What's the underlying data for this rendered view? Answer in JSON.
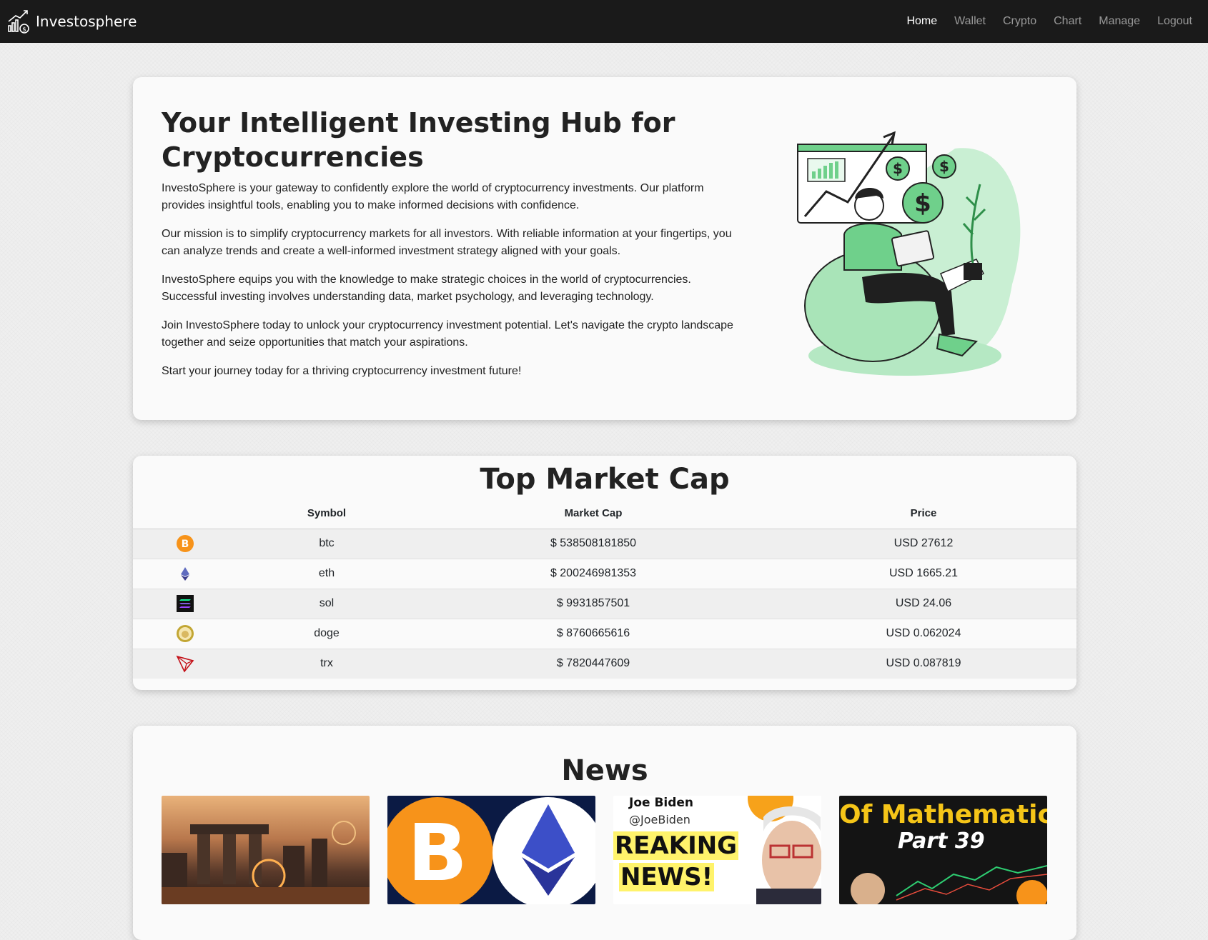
{
  "brand": {
    "name": "Investosphere",
    "icon": "chart-money-icon"
  },
  "nav": [
    {
      "label": "Home",
      "active": true
    },
    {
      "label": "Wallet",
      "active": false
    },
    {
      "label": "Crypto",
      "active": false
    },
    {
      "label": "Chart",
      "active": false
    },
    {
      "label": "Manage",
      "active": false
    },
    {
      "label": "Logout",
      "active": false
    }
  ],
  "hero": {
    "title": "Your Intelligent Investing Hub for Cryptocurrencies",
    "paragraphs": [
      "InvestoSphere is your gateway to confidently explore the world of cryptocurrency investments. Our platform provides insightful tools, enabling you to make informed decisions with confidence.",
      "Our mission is to simplify cryptocurrency markets for all investors. With reliable information at your fingertips, you can analyze trends and create a well-informed investment strategy aligned with your goals.",
      "InvestoSphere equips you with the knowledge to make strategic choices in the world of cryptocurrencies. Successful investing involves understanding data, market psychology, and leveraging technology.",
      "Join InvestoSphere today to unlock your cryptocurrency investment potential. Let's navigate the crypto landscape together and seize opportunities that match your aspirations.",
      "Start your journey today for a thriving cryptocurrency investment future!"
    ]
  },
  "market": {
    "title": "Top Market Cap",
    "headers": [
      "",
      "Symbol",
      "Market Cap",
      "Price"
    ],
    "rows": [
      {
        "icon": "bitcoin-icon",
        "symbol": "btc",
        "market_cap": "$ 538508181850",
        "price": "USD 27612"
      },
      {
        "icon": "ethereum-icon",
        "symbol": "eth",
        "market_cap": "$ 200246981353",
        "price": "USD 1665.21"
      },
      {
        "icon": "solana-icon",
        "symbol": "sol",
        "market_cap": "$ 9931857501",
        "price": "USD 24.06"
      },
      {
        "icon": "dogecoin-icon",
        "symbol": "doge",
        "market_cap": "$ 8760665616",
        "price": "USD 0.062024"
      },
      {
        "icon": "tron-icon",
        "symbol": "trx",
        "market_cap": "$ 7820447609",
        "price": "USD 0.087819"
      }
    ]
  },
  "news": {
    "title": "News",
    "items": [
      {
        "thumb_text": []
      },
      {
        "thumb_text": []
      },
      {
        "thumb_text": [
          "Joe Biden",
          "@JoeBiden",
          "REAKING",
          "NEWS!"
        ]
      },
      {
        "thumb_text": [
          "Of Mathematics",
          "Part 39"
        ]
      }
    ]
  }
}
